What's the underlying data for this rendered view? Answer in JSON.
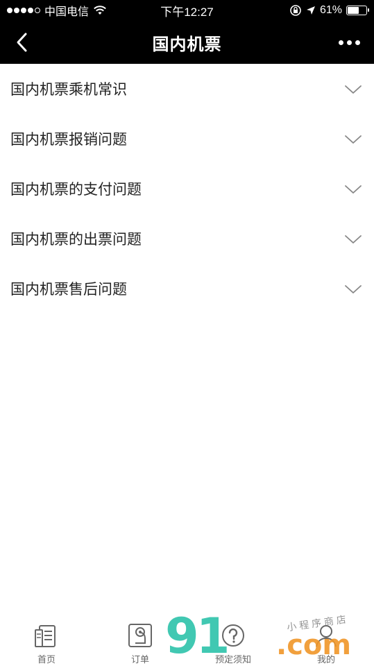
{
  "status_bar": {
    "carrier": "中国电信",
    "time": "下午12:27",
    "battery_percent": "61%",
    "battery_level": 0.61
  },
  "nav": {
    "title": "国内机票",
    "back_icon": "chevron-left-icon",
    "more_icon": "more-horizontal-icon"
  },
  "faq": {
    "items": [
      {
        "label": "国内机票乘机常识"
      },
      {
        "label": "国内机票报销问题"
      },
      {
        "label": "国内机票的支付问题"
      },
      {
        "label": "国内机票的出票问题"
      },
      {
        "label": "国内机票售后问题"
      }
    ]
  },
  "tab_bar": {
    "tabs": [
      {
        "label": "首页",
        "icon": "home-document-icon"
      },
      {
        "label": "订单",
        "icon": "order-icon"
      },
      {
        "label": "预定须知",
        "icon": "question-icon"
      },
      {
        "label": "我的",
        "icon": "user-icon"
      }
    ]
  },
  "watermark": {
    "brand": "91",
    "suffix": ".com",
    "script": "小程序商店"
  },
  "colors": {
    "header_bg": "#000000",
    "text": "#222222",
    "tab_text": "#666666",
    "chevron": "#888888"
  }
}
